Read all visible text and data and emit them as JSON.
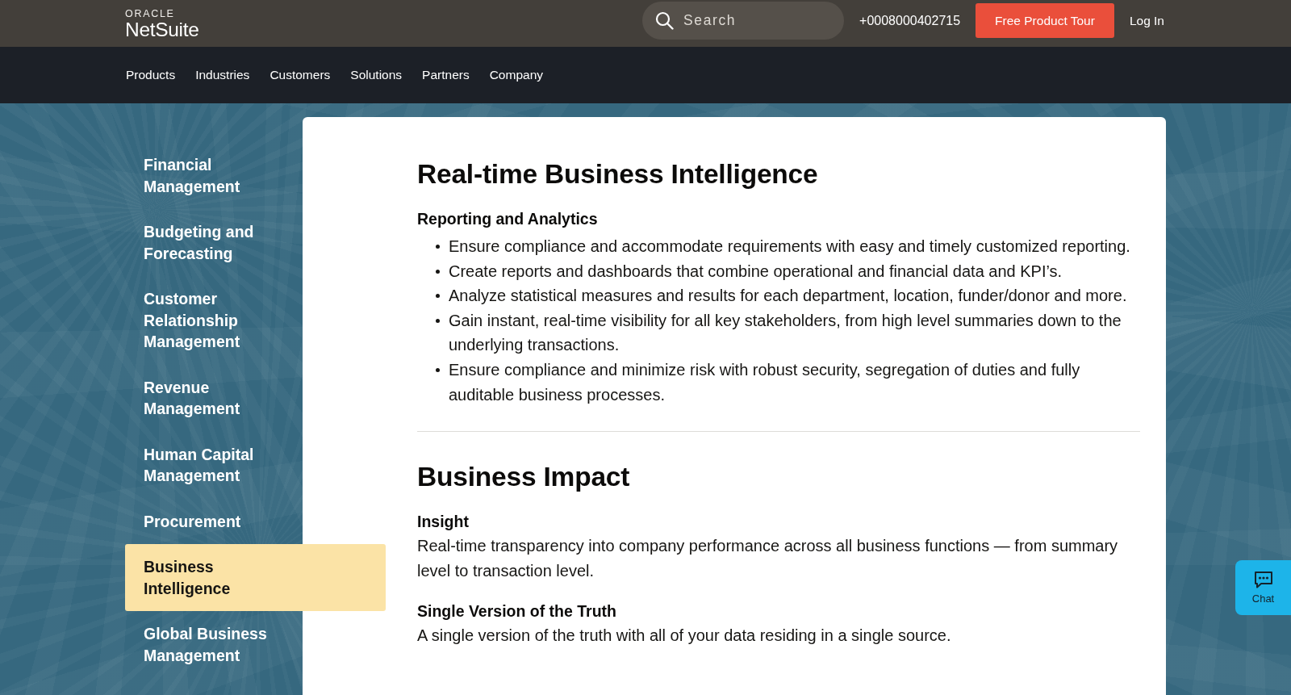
{
  "header": {
    "logo": {
      "company": "ORACLE",
      "product": "NetSuite"
    },
    "search": {
      "placeholder": "Search"
    },
    "phone": "+0008000402715",
    "cta": "Free Product Tour",
    "login": "Log In"
  },
  "nav": [
    "Products",
    "Industries",
    "Customers",
    "Solutions",
    "Partners",
    "Company"
  ],
  "sidebar": {
    "items": [
      {
        "label": "Financial Management",
        "selected": false
      },
      {
        "label": "Budgeting and Forecasting",
        "selected": false
      },
      {
        "label": "Customer Relationship Management",
        "selected": false
      },
      {
        "label": "Revenue Management",
        "selected": false
      },
      {
        "label": "Human Capital Management",
        "selected": false
      },
      {
        "label": "Procurement",
        "selected": false
      },
      {
        "label": "Business Intelligence",
        "selected": true
      },
      {
        "label": "Global Business Management",
        "selected": false
      }
    ]
  },
  "content": {
    "sections": [
      {
        "title": "Real-time Business Intelligence",
        "blocks": [
          {
            "kind": "list",
            "heading": "Reporting and Analytics",
            "items": [
              "Ensure compliance and accommodate requirements with easy and timely customized reporting.",
              "Create reports and dashboards that combine operational and financial data and KPI’s.",
              "Analyze statistical measures and results for each department, location, funder/donor and more.",
              "Gain instant, real-time visibility for all key stakeholders, from high level summaries down to the underlying transactions.",
              "Ensure compliance and minimize risk with robust security, segregation of duties and fully auditable business processes."
            ]
          }
        ]
      },
      {
        "title": "Business Impact",
        "blocks": [
          {
            "kind": "paragraph",
            "heading": "Insight",
            "text": "Real-time transparency into company performance across all business functions — from summary level to transaction level."
          },
          {
            "kind": "paragraph",
            "heading": "Single Version of the Truth",
            "text": "A single version of the truth with all of your data residing in a single source."
          }
        ]
      }
    ]
  },
  "chat": {
    "label": "Chat"
  }
}
